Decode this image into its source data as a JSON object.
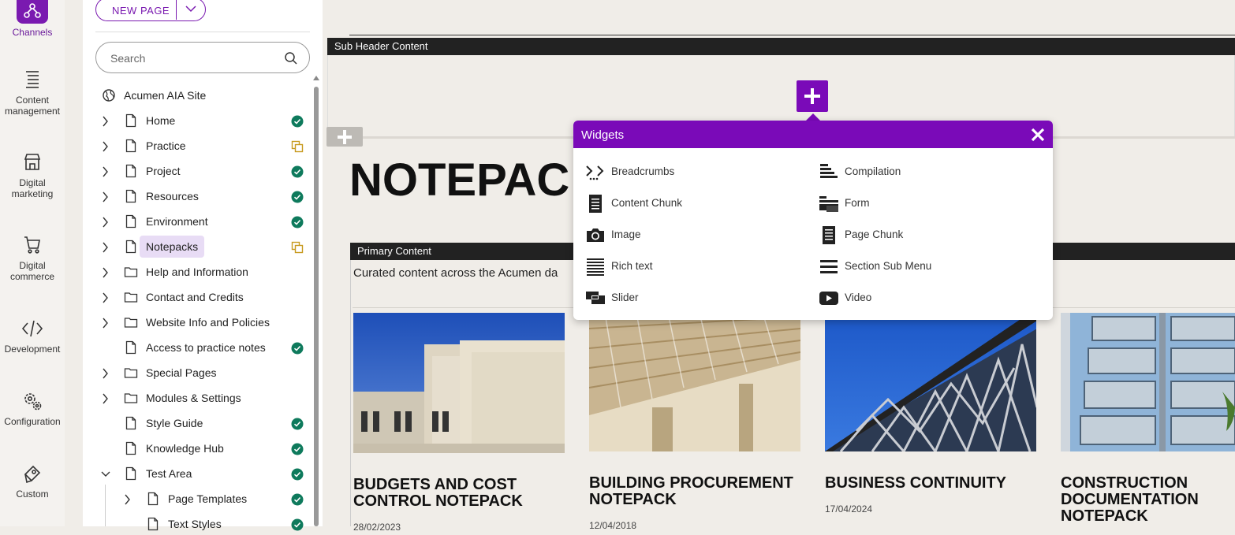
{
  "rail": {
    "items": [
      {
        "label": "Channels",
        "icon": "channels-icon"
      },
      {
        "label": "Content management",
        "icon": "content-management-icon"
      },
      {
        "label": "Digital marketing",
        "icon": "digital-marketing-icon"
      },
      {
        "label": "Digital commerce",
        "icon": "cart-icon"
      },
      {
        "label": "Development",
        "icon": "code-icon"
      },
      {
        "label": "Configuration",
        "icon": "gears-icon"
      },
      {
        "label": "Custom",
        "icon": "custom-icon"
      }
    ]
  },
  "sidebar": {
    "new_page_label": "NEW PAGE",
    "search_placeholder": "Search",
    "site_name": "Acumen AIA Site",
    "tree": [
      {
        "label": "Home",
        "status": "published"
      },
      {
        "label": "Practice",
        "status": "draft"
      },
      {
        "label": "Project",
        "status": "published"
      },
      {
        "label": "Resources",
        "status": "published"
      },
      {
        "label": "Environment",
        "status": "published"
      },
      {
        "label": "Notepacks",
        "status": "draft"
      },
      {
        "label": "Help and Information",
        "status": ""
      },
      {
        "label": "Contact and Credits",
        "status": ""
      },
      {
        "label": "Website Info and Policies",
        "status": ""
      },
      {
        "label": "Access to practice notes",
        "status": "published"
      },
      {
        "label": "Special Pages",
        "status": ""
      },
      {
        "label": "Modules & Settings",
        "status": ""
      },
      {
        "label": "Style Guide",
        "status": "published"
      },
      {
        "label": "Knowledge Hub",
        "status": "published"
      },
      {
        "label": "Test Area",
        "status": "published"
      },
      {
        "label": "Page Templates",
        "status": "published"
      },
      {
        "label": "Text Styles",
        "status": "published"
      }
    ]
  },
  "main": {
    "sub_header_label": "Sub Header Content",
    "page_title": "NOTEPAC",
    "primary_label": "Primary Content",
    "curated_text": "Curated content across the Acumen da",
    "cards": [
      {
        "title": "BUDGETS AND COST CONTROL NOTEPACK",
        "date": "28/02/2023"
      },
      {
        "title": "BUILDING PROCUREMENT NOTEPACK",
        "date": "12/04/2018"
      },
      {
        "title": "BUSINESS CONTINUITY",
        "date": "17/04/2024"
      },
      {
        "title": "CONSTRUCTION DOCUMENTATION NOTEPACK",
        "date": ""
      }
    ]
  },
  "widgets": {
    "title": "Widgets",
    "items": [
      {
        "label": "Breadcrumbs",
        "icon": "breadcrumbs-icon"
      },
      {
        "label": "Compilation",
        "icon": "compilation-icon"
      },
      {
        "label": "Content Chunk",
        "icon": "content-chunk-icon"
      },
      {
        "label": "Form",
        "icon": "form-icon"
      },
      {
        "label": "Image",
        "icon": "camera-icon"
      },
      {
        "label": "Page Chunk",
        "icon": "page-chunk-icon"
      },
      {
        "label": "Rich text",
        "icon": "rich-text-icon"
      },
      {
        "label": "Section Sub Menu",
        "icon": "menu-icon"
      },
      {
        "label": "Slider",
        "icon": "slider-icon"
      },
      {
        "label": "Video",
        "icon": "video-icon"
      }
    ]
  },
  "colors": {
    "accent": "#7a0ab8",
    "published": "#0e7a5c",
    "draft": "#c79a1e"
  }
}
